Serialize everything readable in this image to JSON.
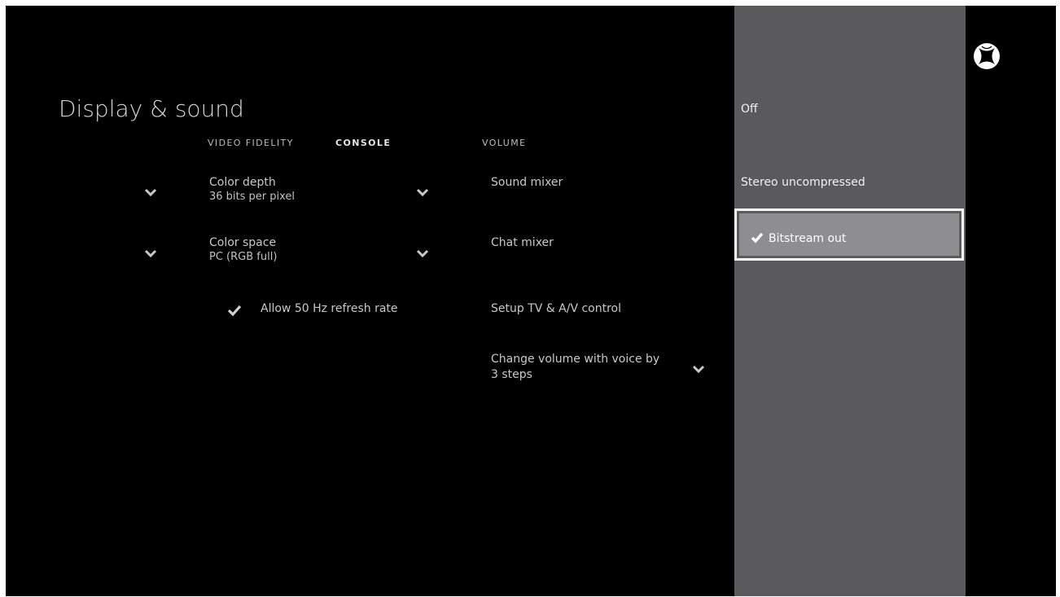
{
  "page": {
    "title": "Display & sound"
  },
  "sections": {
    "video_fidelity": "VIDEO FIDELITY",
    "console": "CONSOLE",
    "volume": "VOLUME"
  },
  "left_items": [
    {
      "label": "Color depth",
      "value": "36 bits per pixel"
    },
    {
      "label": "Color space",
      "value": "PC (RGB full)"
    }
  ],
  "toggle": {
    "label": "Allow 50 Hz refresh rate",
    "checked": true
  },
  "volume_items": [
    {
      "label": "Sound mixer"
    },
    {
      "label": "Chat mixer"
    },
    {
      "label": "Setup TV & A/V control"
    },
    {
      "label_line1": "Change volume with voice by",
      "label_line2": "3 steps"
    }
  ],
  "options_panel": {
    "options": [
      "Off",
      "Stereo uncompressed",
      "Bitstream out"
    ],
    "selected": "Bitstream out"
  },
  "icons": {
    "logo": "xbox-logo-icon",
    "expand": "chevron-down-icon",
    "check": "checkmark-icon"
  },
  "colors": {
    "background": "#000000",
    "panel": "#5a5a5c",
    "selected_bg": "#8e8e90",
    "focus_border": "#ffffff"
  }
}
